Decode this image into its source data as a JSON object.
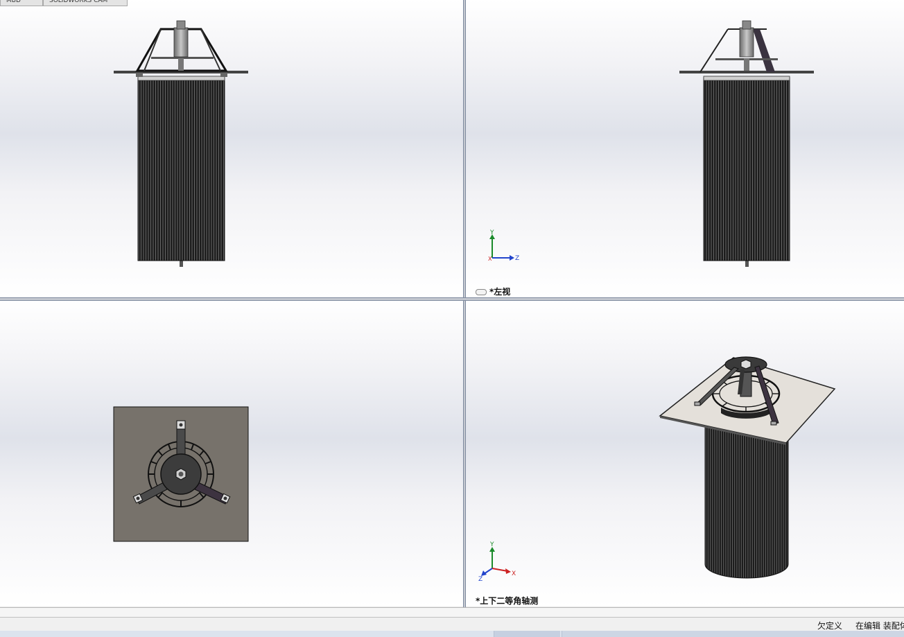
{
  "tabs": [
    {
      "label": "MBD"
    },
    {
      "label": "SOLIDWORKS CAM"
    }
  ],
  "viewports": {
    "top_right": {
      "label": "*左视"
    },
    "bottom_right": {
      "label": "*上下二等角轴测"
    }
  },
  "triad_left": {
    "y": "Y",
    "x": "X",
    "z": "Z"
  },
  "triad_iso": {
    "y": "Y",
    "z": "Z",
    "x": "X"
  },
  "heads_up_toolbar": [
    {
      "icon": "zoom-to-fit-icon"
    },
    {
      "icon": "zoom-to-area-icon"
    },
    {
      "icon": "previous-view-icon"
    },
    {
      "icon": "section-view-icon"
    },
    {
      "icon": "dynamic-annotation-icon"
    },
    {
      "icon": "view-orientation-icon"
    },
    {
      "icon": "display-style-icon"
    },
    {
      "icon": "hide-show-items-icon"
    },
    {
      "icon": "edit-appearance-icon"
    },
    {
      "icon": "apply-scene-icon"
    },
    {
      "icon": "view-settings-icon"
    }
  ],
  "status": {
    "definition": "欠定义",
    "editing": "在编辑 装配体"
  },
  "colors": {
    "accent": "#1f4e9a",
    "body_dark": "#1a1a1a",
    "plate_face": "#e4e0da",
    "plate_top_view": "#77726b"
  }
}
